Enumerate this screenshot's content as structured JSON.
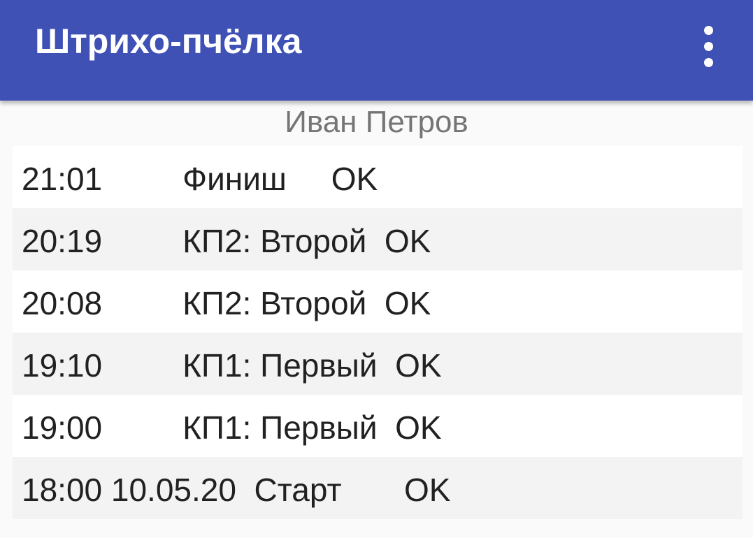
{
  "app": {
    "title": "Штрихо-пчёлка",
    "menu_icon": "more-vert-icon"
  },
  "participant": {
    "name": "Иван Петров"
  },
  "log": [
    {
      "text": "21:01         Финиш     OK"
    },
    {
      "text": "20:19         КП2: Второй  OK"
    },
    {
      "text": "20:08         КП2: Второй  OK"
    },
    {
      "text": "19:10         КП1: Первый  OK"
    },
    {
      "text": "19:00         КП1: Первый  OK"
    },
    {
      "text": "18:00 10.05.20  Старт       OK"
    }
  ],
  "colors": {
    "appbar": "#3f51b5",
    "background": "#fafafa",
    "row": "#ffffff",
    "row_alt": "#f3f3f3",
    "text_primary": "#212121",
    "text_secondary": "#757575"
  }
}
